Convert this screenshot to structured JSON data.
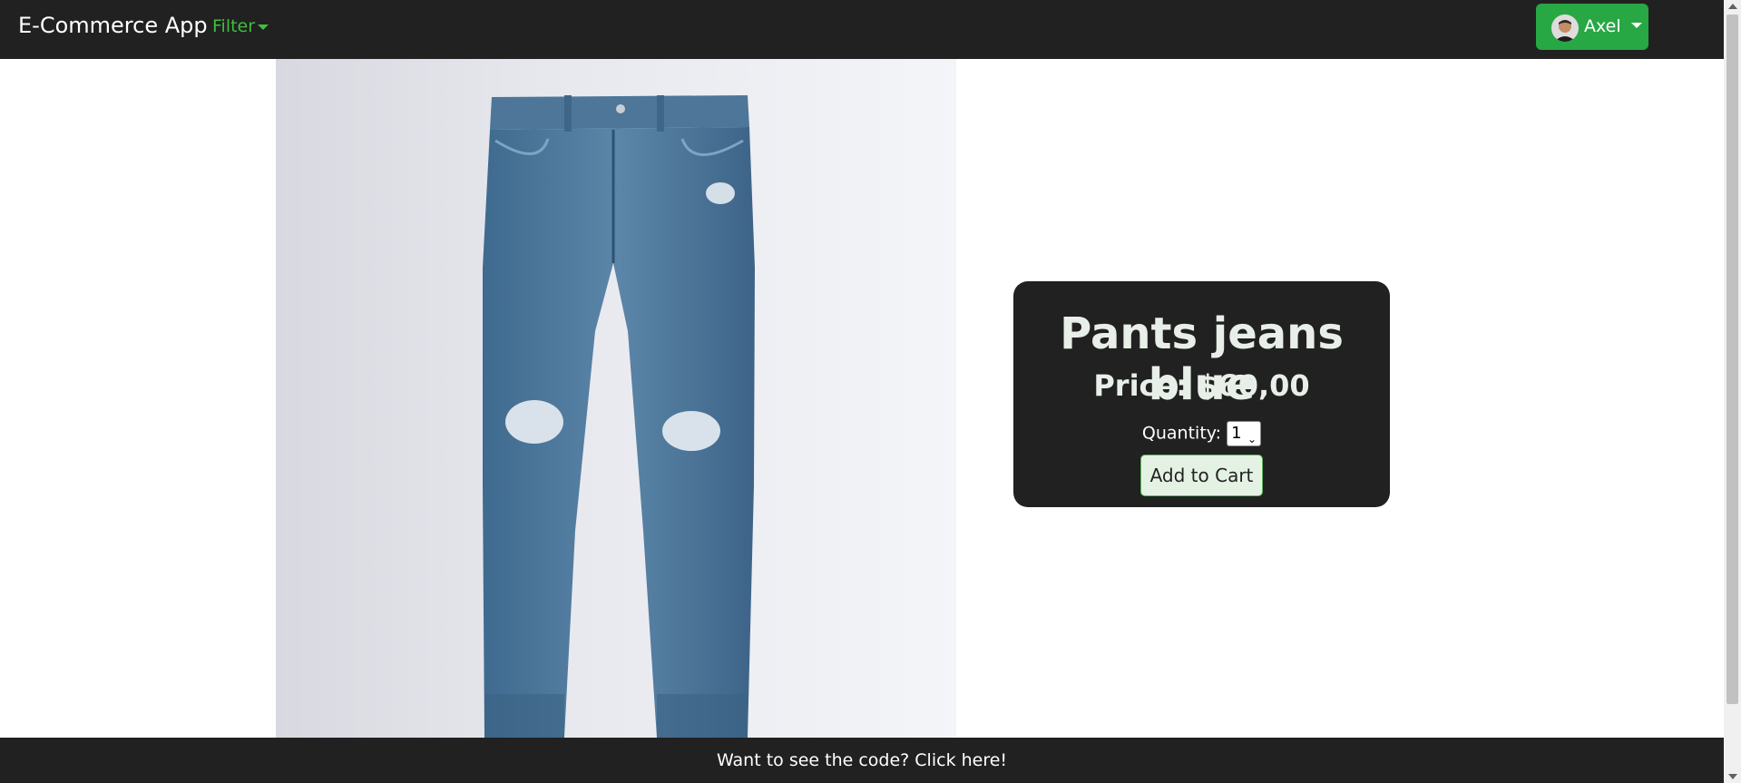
{
  "navbar": {
    "brand": "E-Commerce App",
    "filter_label": "Filter",
    "user_name": "Axel"
  },
  "product": {
    "image_alt": "Pants jeans blue",
    "title": "Pants jeans blue",
    "price_text": "Price: $60,00",
    "quantity_label": "Quantity:",
    "quantity_value": "1",
    "add_to_cart_label": "Add to Cart"
  },
  "footer": {
    "text": "Want to see the code? Click here!"
  },
  "colors": {
    "navbar_bg": "#212121",
    "accent_green": "#28a745",
    "filter_green": "#3fbf3f",
    "card_bg": "#212121"
  },
  "icons": {
    "user_avatar": "avatar",
    "dropdown": "caret-down-icon"
  }
}
